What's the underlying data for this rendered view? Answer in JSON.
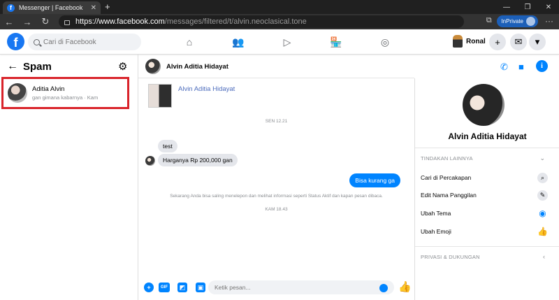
{
  "browser": {
    "tab_title": "Messenger | Facebook",
    "tab_close": "✕",
    "new_tab": "+",
    "url_host": "https://www.facebook.com",
    "url_path": "/messages/filtered/t/alvin.neoclasical.tone",
    "inprivate_label": "InPrivate",
    "back": "←",
    "forward": "→",
    "refresh": "↻",
    "more": "···",
    "minimize": "—",
    "maximize": "❐",
    "close": "✕"
  },
  "topbar": {
    "logo": "f",
    "search_placeholder": "Cari di Facebook",
    "profile_name": "Ronal",
    "nav_icons": [
      "home-icon",
      "friends-icon",
      "watch-icon",
      "marketplace-icon",
      "groups-icon"
    ]
  },
  "sidebar": {
    "title": "Spam",
    "conversation": {
      "name": "Aditia Alvin",
      "preview": "gan gimana kabarnya · Kam"
    }
  },
  "chat": {
    "contact_name": "Alvin Aditia Hidayat",
    "intro_name": "Alvin Aditia Hidayat",
    "timestamp_1": "SEN 12.21",
    "msg_in_1": "test",
    "msg_in_2": "Harganya Rp 200,000 gan",
    "msg_out_1": "Bisa kurang ga",
    "notice": "Sekarang Anda bisa saling menelepon dan melihat informasi seperti Status Aktif dan kapan pesan dibaca.",
    "timestamp_2": "KAM 18.43",
    "composer_placeholder": "Ketik pesan...",
    "gif_label": "GIF"
  },
  "info_panel": {
    "name": "Alvin Aditia Hidayat",
    "section_1": "TINDAKAN LAINNYA",
    "actions": [
      {
        "label": "Cari di Percakapan"
      },
      {
        "label": "Edit Nama Panggilan"
      },
      {
        "label": "Ubah Tema"
      },
      {
        "label": "Ubah Emoji"
      }
    ],
    "section_2": "PRIVASI & DUKUNGAN"
  },
  "colors": {
    "accent": "#0084ff",
    "brand": "#1877f2",
    "highlight_border": "#d9232a"
  }
}
